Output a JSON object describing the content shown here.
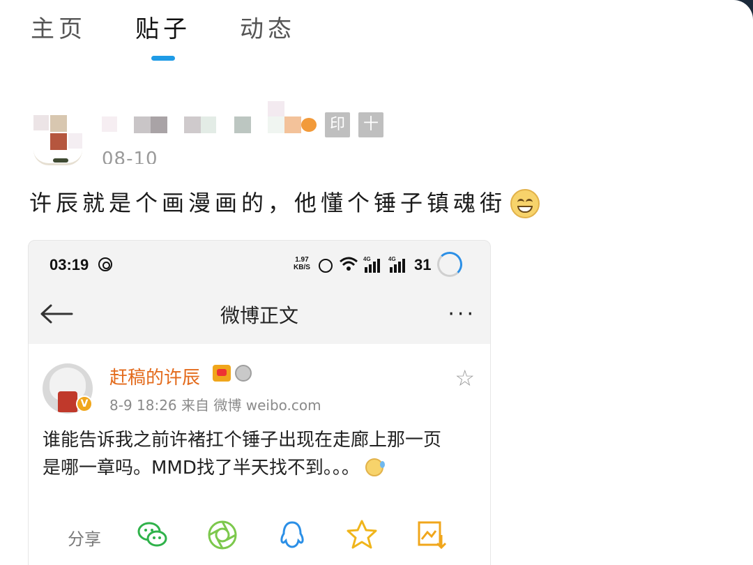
{
  "tabs": [
    {
      "label": "主页"
    },
    {
      "label": "贴子"
    },
    {
      "label": "动态"
    }
  ],
  "post": {
    "date": "08-10",
    "badge_print": "印",
    "badge_plus": "十",
    "text": "许辰就是个画漫画的，他懂个锤子镇魂街"
  },
  "screenshot": {
    "status": {
      "time": "03:19",
      "speed_value": "1.97",
      "speed_unit": "KB/S",
      "net1": "4G",
      "net2": "4G",
      "battery": "31"
    },
    "nav": {
      "title": "微博正文",
      "more": "···"
    },
    "weibo": {
      "author": "赶稿的许辰",
      "verified_mark": "V",
      "meta": "8-9 18:26   来自 微博 weibo.com",
      "text_line1": "谁能告诉我之前许褚扛个锤子出现在走廊上那一页",
      "text_line2": "是哪一章吗。MMD找了半天找不到。。。",
      "share_label": "分享"
    }
  },
  "colors": {
    "tab_indicator": "#1f9be6",
    "weibo_name": "#e36a1b",
    "wechat": "#2fb24a",
    "moments": "#7cc84c",
    "qq": "#2b8fe6",
    "qzone": "#f0b51b",
    "album": "#f0a61b"
  }
}
